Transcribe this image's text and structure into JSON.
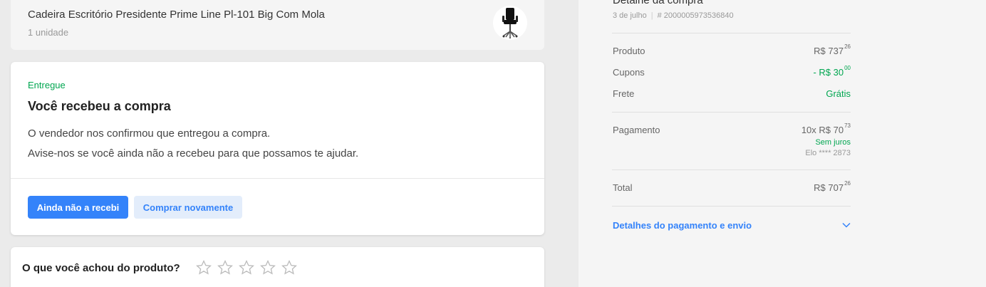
{
  "product": {
    "name": "Cadeira Escritório Presidente Prime Line Pl-101 Big Com Mola",
    "quantity": "1 unidade",
    "thumbnail_icon": "office-chair-icon"
  },
  "status": {
    "label": "Entregue",
    "title": "Você recebeu a compra",
    "line1": "O vendedor nos confirmou que entregou a compra.",
    "line2": "Avise-nos se você ainda não a recebeu para que possamos te ajudar.",
    "primary_button": "Ainda não a recebi",
    "secondary_button": "Comprar novamente"
  },
  "rating": {
    "question": "O que você achou do produto?",
    "stars_total": 5,
    "stars_filled": 0
  },
  "summary": {
    "title": "Detalhe da compra",
    "date": "3 de julho",
    "order_id": "# 2000005973536840",
    "product_label": "Produto",
    "product_value": "R$ 737",
    "product_cents": "26",
    "coupons_label": "Cupons",
    "coupons_value": "- R$ 30",
    "coupons_cents": "00",
    "shipping_label": "Frete",
    "shipping_value": "Grátis",
    "payment_label": "Pagamento",
    "payment_value": "10x R$ 70",
    "payment_cents": "73",
    "payment_interest": "Sem juros",
    "payment_card": "Elo **** 2873",
    "total_label": "Total",
    "total_value": "R$ 707",
    "total_cents": "26",
    "details_link": "Detalhes do pagamento e envio"
  },
  "colors": {
    "accent": "#3483fa",
    "success": "#00a650",
    "background": "#ebebeb"
  }
}
